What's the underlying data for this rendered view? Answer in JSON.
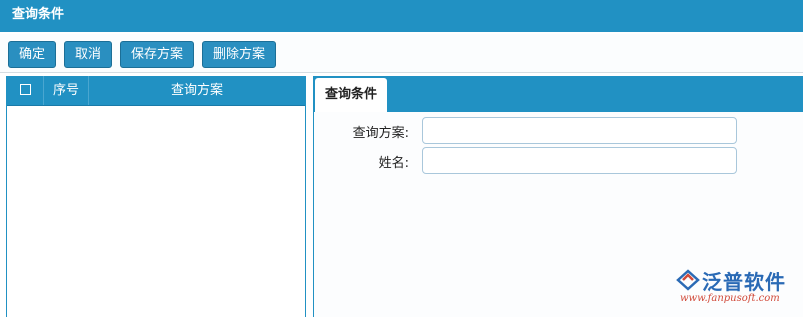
{
  "window": {
    "title": "查询条件"
  },
  "toolbar": {
    "confirm_label": "确定",
    "cancel_label": "取消",
    "save_plan_label": "保存方案",
    "delete_plan_label": "删除方案"
  },
  "grid": {
    "columns": [
      "序号",
      "查询方案"
    ],
    "rows": []
  },
  "tabs": [
    {
      "label": "查询条件",
      "active": true
    }
  ],
  "form": {
    "fields": [
      {
        "label": "查询方案:",
        "value": ""
      },
      {
        "label": "姓名:",
        "value": ""
      }
    ]
  },
  "watermark": {
    "brand": "泛普软件",
    "url": "www.fanpusoft.com"
  },
  "colors": {
    "primary": "#2191c3",
    "button": "#2a8fc0",
    "input_border": "#a9c7db"
  }
}
